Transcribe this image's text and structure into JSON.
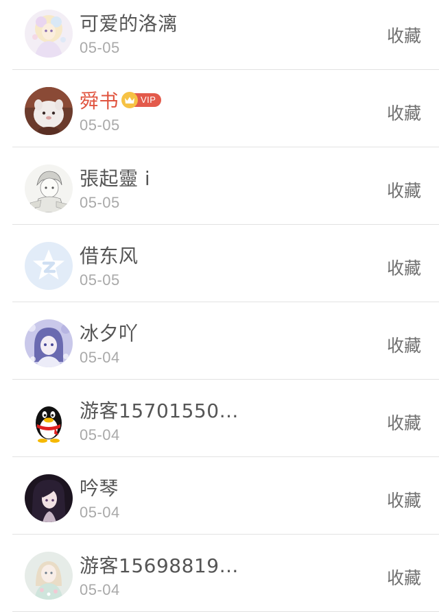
{
  "action_label": "收藏",
  "vip_badge_text": "VIP",
  "colors": {
    "name": "#555555",
    "vip_name": "#e0533e",
    "date": "#a9a9a9",
    "action": "#707070",
    "divider": "#e2e2e2",
    "vip_tag": "#e35a4b",
    "vip_crown": "#f6c244"
  },
  "items": [
    {
      "name": "可爱的洛漓",
      "date": "05-05",
      "vip": false,
      "avatar": "anime-girl-pastel-avatar"
    },
    {
      "name": "舜书",
      "date": "05-05",
      "vip": true,
      "avatar": "white-fluffy-creature-avatar"
    },
    {
      "name": "張起靈 i",
      "date": "05-05",
      "vip": false,
      "avatar": "sketch-anime-avatar"
    },
    {
      "name": "借东风",
      "date": "05-05",
      "vip": false,
      "avatar": "default-star-avatar"
    },
    {
      "name": "冰夕吖",
      "date": "05-04",
      "vip": false,
      "avatar": "anime-girl-blue-avatar"
    },
    {
      "name": "游客15701550…",
      "date": "05-04",
      "vip": false,
      "avatar": "qq-penguin-avatar"
    },
    {
      "name": "吟琴",
      "date": "05-04",
      "vip": false,
      "avatar": "dark-hair-girl-avatar"
    },
    {
      "name": "游客15698819…",
      "date": "05-04",
      "vip": false,
      "avatar": "doll-avatar"
    }
  ]
}
